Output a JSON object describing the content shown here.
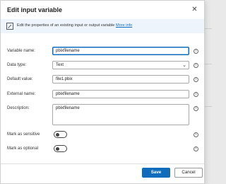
{
  "dialog": {
    "title": "Edit input variable",
    "banner_text": "Edit the properties of an existing input or output variable",
    "banner_link": "More info"
  },
  "form": {
    "variable_name": {
      "label": "Variable name:",
      "value": "pbixfilename"
    },
    "data_type": {
      "label": "Data type:",
      "value": "Text"
    },
    "default_value": {
      "label": "Default value:",
      "value": "file1.pbix"
    },
    "external_name": {
      "label": "External name:",
      "value": "pbixfilename"
    },
    "description": {
      "label": "Description:",
      "value": "pbixfilename"
    },
    "sensitive": {
      "label": "Mark as sensitive",
      "on": false
    },
    "optional": {
      "label": "Mark as optional",
      "on": false
    }
  },
  "footer": {
    "save_label": "Save",
    "cancel_label": "Cancel"
  },
  "icons": {
    "close": "close-icon",
    "banner": "edit-info-icon",
    "info": "info-icon",
    "chevron": "chevron-down-icon"
  },
  "colors": {
    "accent": "#0f6cbd",
    "banner_bg": "#eef4fb"
  }
}
